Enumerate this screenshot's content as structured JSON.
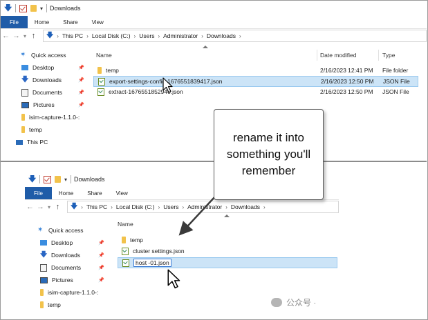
{
  "callout": {
    "text": "rename it into something you'll remember"
  },
  "watermark": {
    "text": "公众号 ·"
  },
  "top": {
    "title": "Downloads",
    "ribbon": [
      "File",
      "Home",
      "Share",
      "View"
    ],
    "address": [
      "This PC",
      "Local Disk (C:)",
      "Users",
      "Administrator",
      "Downloads"
    ],
    "columns": {
      "name": "Name",
      "date": "Date modified",
      "type": "Type"
    },
    "files": [
      {
        "name": "temp",
        "icon": "folder-icon",
        "date": "2/16/2023 12:41 PM",
        "type": "File folder"
      },
      {
        "name": "export-settings-config-1676551839417.json",
        "icon": "json-file-icon",
        "date": "2/16/2023 12:50 PM",
        "type": "JSON File",
        "selected": true
      },
      {
        "name": "extract-1676551852940.json",
        "icon": "json-file-icon",
        "date": "2/16/2023 12:50 PM",
        "type": "JSON File"
      }
    ],
    "nav": [
      {
        "label": "Quick access",
        "icon": "star-icon"
      },
      {
        "label": "Desktop",
        "icon": "desktop-icon",
        "pinned": true
      },
      {
        "label": "Downloads",
        "icon": "download-icon",
        "pinned": true
      },
      {
        "label": "Documents",
        "icon": "documents-icon",
        "pinned": true
      },
      {
        "label": "Pictures",
        "icon": "pictures-icon",
        "pinned": true
      },
      {
        "label": "isim-capture-1.1.0-:",
        "icon": "folder-icon"
      },
      {
        "label": "temp",
        "icon": "folder-icon"
      },
      {
        "label": "This PC",
        "icon": "this-pc-icon"
      }
    ]
  },
  "bottom": {
    "title": "Downloads",
    "ribbon": [
      "File",
      "Home",
      "Share",
      "View"
    ],
    "address": [
      "This PC",
      "Local Disk (C:)",
      "Users",
      "Administrator",
      "Downloads"
    ],
    "columns": {
      "name": "Name"
    },
    "files": [
      {
        "name": "temp",
        "icon": "folder-icon"
      },
      {
        "name": "cluster settings.json",
        "icon": "json-file-icon"
      },
      {
        "name": "host -01.json",
        "icon": "json-file-icon",
        "editing": true
      }
    ],
    "nav": [
      {
        "label": "Quick access",
        "icon": "star-icon"
      },
      {
        "label": "Desktop",
        "icon": "desktop-icon",
        "pinned": true
      },
      {
        "label": "Downloads",
        "icon": "download-icon",
        "pinned": true
      },
      {
        "label": "Documents",
        "icon": "documents-icon",
        "pinned": true
      },
      {
        "label": "Pictures",
        "icon": "pictures-icon",
        "pinned": true
      },
      {
        "label": "isim-capture-1.1.0-:",
        "icon": "folder-icon"
      },
      {
        "label": "temp",
        "icon": "folder-icon"
      }
    ]
  }
}
